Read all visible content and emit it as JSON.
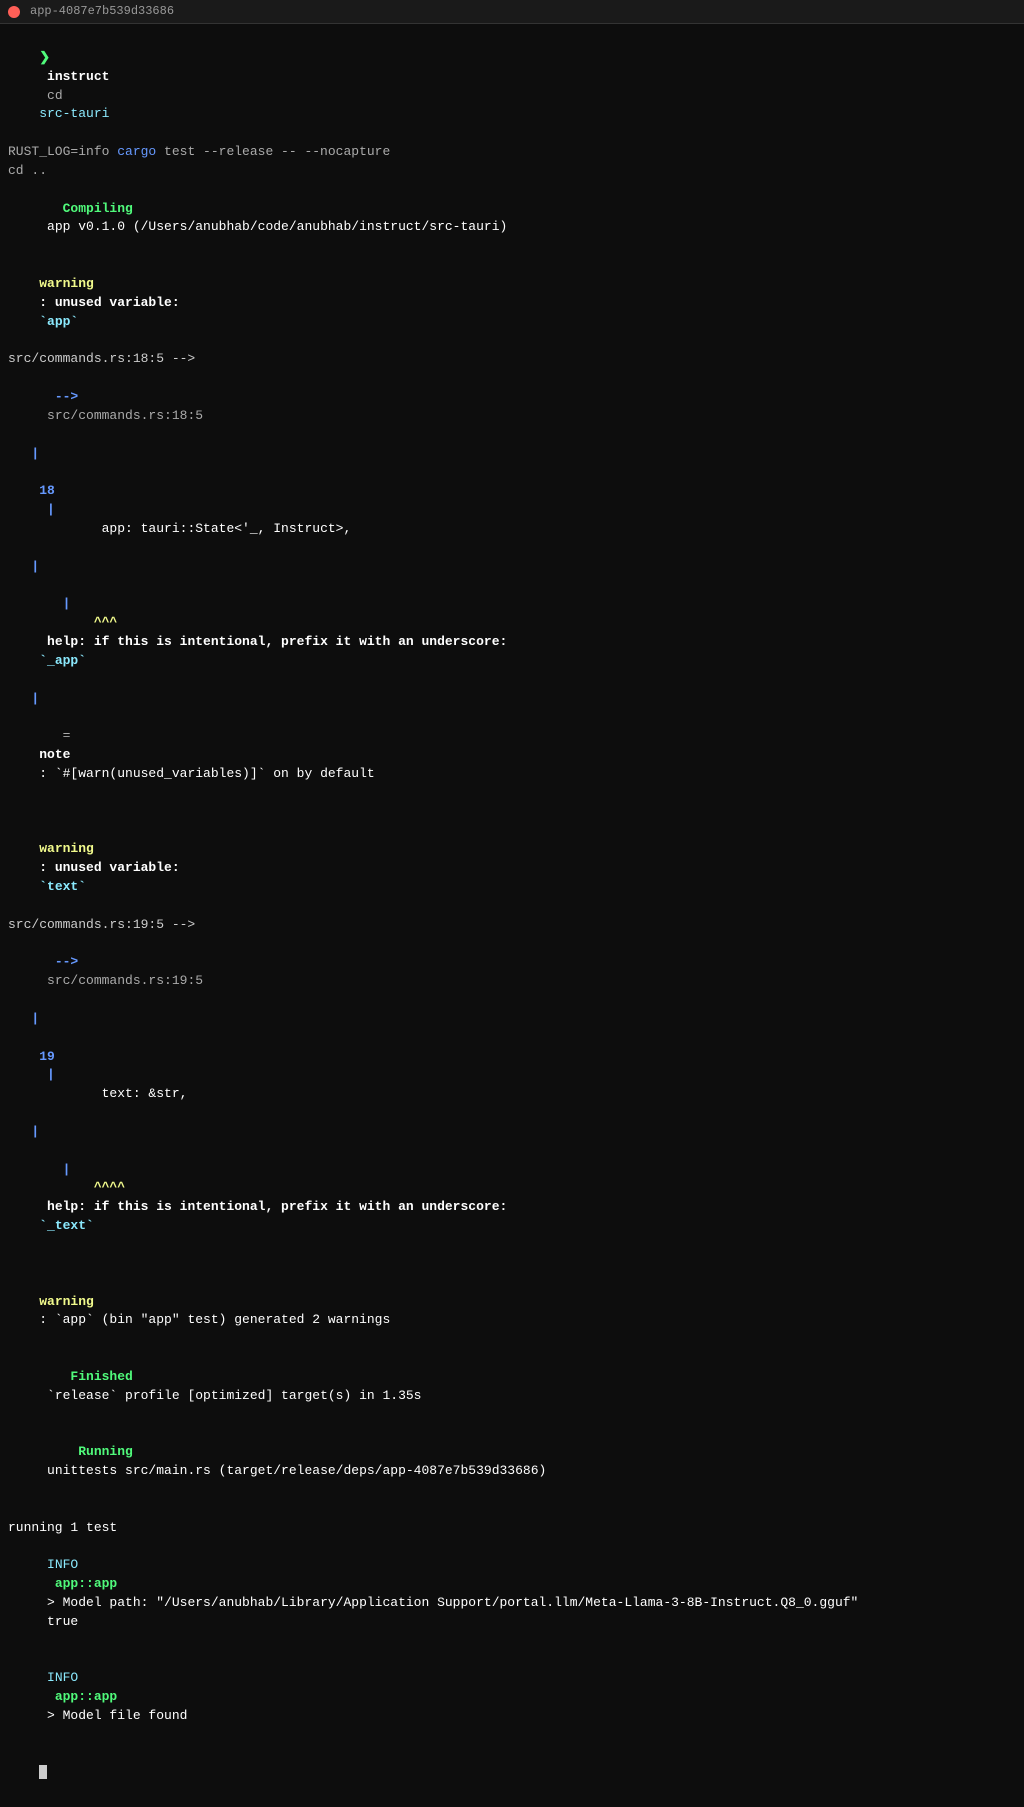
{
  "titleBar": {
    "title": "app-4087e7b539d33686"
  },
  "terminal": {
    "lines": [
      {
        "id": "prompt",
        "type": "prompt"
      },
      {
        "id": "rust-log",
        "type": "plain",
        "text": "RUST_LOG=info cargo test --release -- --nocapture"
      },
      {
        "id": "cd",
        "type": "plain",
        "text": "cd .."
      },
      {
        "id": "compiling",
        "type": "compiling"
      },
      {
        "id": "warn1-header",
        "type": "warn-header",
        "var": "app"
      },
      {
        "id": "warn1-arrow",
        "type": "warn-arrow",
        "file": "src/commands.rs:18:5"
      },
      {
        "id": "warn1-pipe1",
        "type": "pipe-empty"
      },
      {
        "id": "warn1-line18",
        "type": "code-line",
        "num": "18",
        "code": "        app: tauri::State<'_, Instruct>,"
      },
      {
        "id": "warn1-pipe2",
        "type": "pipe-empty"
      },
      {
        "id": "warn1-help1",
        "type": "pipe-help",
        "carets": "^^^",
        "msg": "help: if this is intentional, prefix it with an underscore: `_app`"
      },
      {
        "id": "warn1-pipe3",
        "type": "pipe-empty"
      },
      {
        "id": "warn1-note",
        "type": "note-line",
        "msg": "note: `#[warn(unused_variables)]` on by default"
      },
      {
        "id": "blank1",
        "type": "blank"
      },
      {
        "id": "warn2-header",
        "type": "warn-header",
        "var": "text"
      },
      {
        "id": "warn2-arrow",
        "type": "warn-arrow",
        "file": "src/commands.rs:19:5"
      },
      {
        "id": "warn2-pipe1",
        "type": "pipe-empty"
      },
      {
        "id": "warn2-line19",
        "type": "code-line",
        "num": "19",
        "code": "        text: &str,"
      },
      {
        "id": "warn2-pipe2",
        "type": "pipe-empty"
      },
      {
        "id": "warn2-help",
        "type": "pipe-help",
        "carets": "^^^^",
        "msg": "help: if this is intentional, prefix it with an underscore: `_text`"
      },
      {
        "id": "blank2",
        "type": "blank"
      },
      {
        "id": "warn3",
        "type": "warn-generated"
      },
      {
        "id": "finished",
        "type": "finished"
      },
      {
        "id": "running",
        "type": "running-tests"
      },
      {
        "id": "blank3",
        "type": "blank"
      },
      {
        "id": "running-count",
        "type": "running-count"
      },
      {
        "id": "info1",
        "type": "info-model-path"
      },
      {
        "id": "info2",
        "type": "info-model-found"
      }
    ]
  }
}
